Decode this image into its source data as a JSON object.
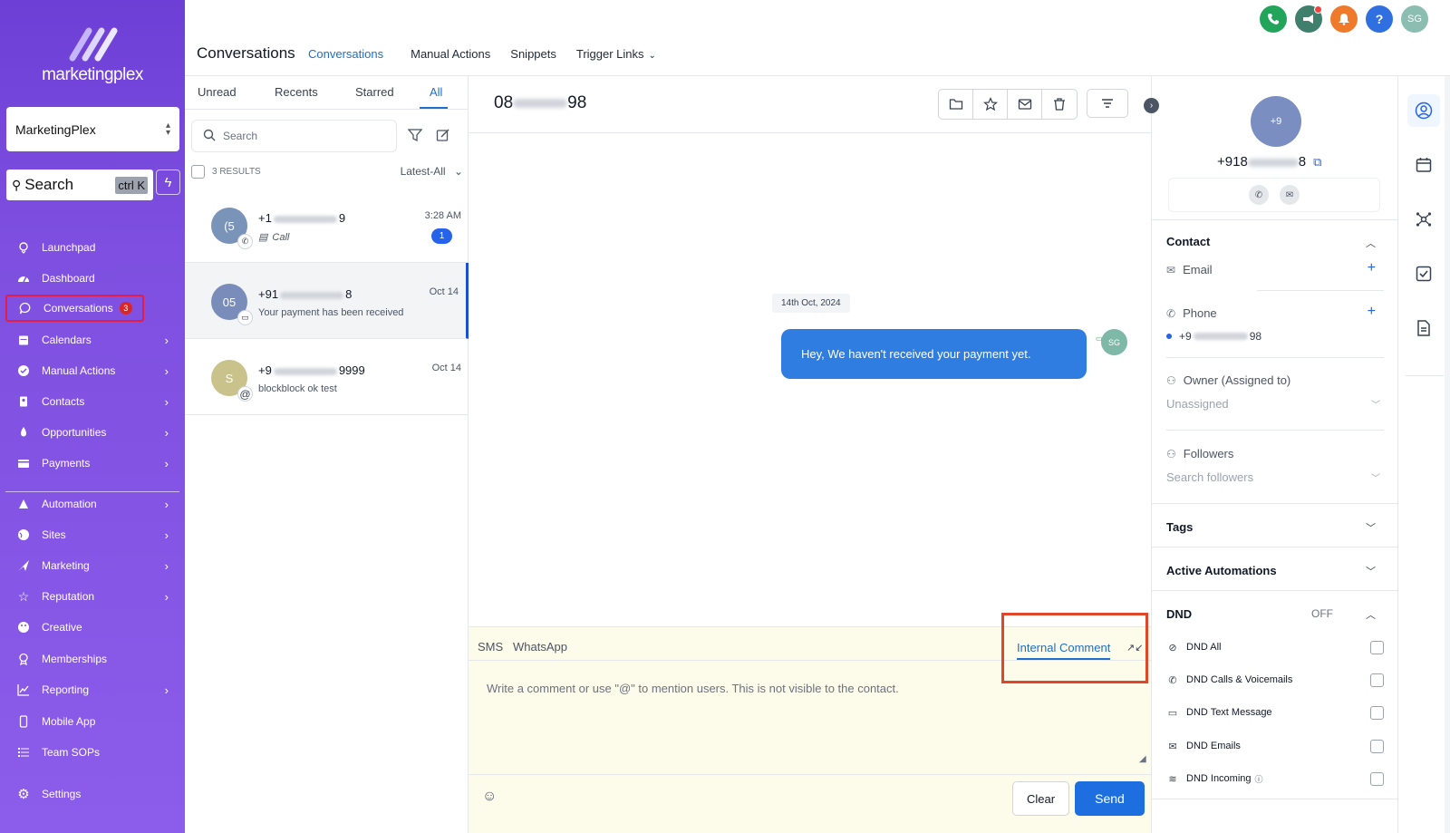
{
  "brand": {
    "name": "marketingplex"
  },
  "sidebar": {
    "account": "MarketingPlex",
    "search": {
      "placeholder": "Search",
      "shortcut": "ctrl K"
    },
    "items": [
      {
        "label": "Launchpad",
        "icon": "rocket-icon"
      },
      {
        "label": "Dashboard",
        "icon": "gauge-icon"
      },
      {
        "label": "Conversations",
        "icon": "chat-icon",
        "badge": "3",
        "active": true
      },
      {
        "label": "Calendars",
        "icon": "calendar-icon"
      },
      {
        "label": "Manual Actions",
        "icon": "check-circle-icon"
      },
      {
        "label": "Contacts",
        "icon": "contact-card-icon"
      },
      {
        "label": "Opportunities",
        "icon": "funnel-icon"
      },
      {
        "label": "Payments",
        "icon": "credit-card-icon"
      },
      {
        "label": "Automation",
        "icon": "robot-icon"
      },
      {
        "label": "Sites",
        "icon": "globe-icon"
      },
      {
        "label": "Marketing",
        "icon": "send-icon"
      },
      {
        "label": "Reputation",
        "icon": "star-icon"
      },
      {
        "label": "Creative",
        "icon": "palette-icon"
      },
      {
        "label": "Memberships",
        "icon": "award-icon"
      },
      {
        "label": "Reporting",
        "icon": "chart-icon"
      },
      {
        "label": "Mobile App",
        "icon": "phone-device-icon"
      },
      {
        "label": "Team SOPs",
        "icon": "list-icon"
      },
      {
        "label": "Settings",
        "icon": "gear-icon"
      }
    ]
  },
  "header": {
    "title": "Conversations",
    "tabs": [
      {
        "label": "Conversations",
        "active": true
      },
      {
        "label": "Manual Actions"
      },
      {
        "label": "Snippets"
      },
      {
        "label": "Trigger Links",
        "dropdown": true
      }
    ],
    "user_initials": "SG",
    "help": "?"
  },
  "conversation_list": {
    "tabs": [
      "Unread",
      "Recents",
      "Starred",
      "All"
    ],
    "active_tab": "All",
    "search_placeholder": "Search",
    "results": "3 RESULTS",
    "sort": "Latest-All",
    "items": [
      {
        "initials": "(5",
        "name_prefix": "+1",
        "name_suffix": "9",
        "subtitle": "Call",
        "time": "3:28 AM",
        "unread": "1",
        "avatar_color": "#7a93b8",
        "channel_icon": "phone-icon"
      },
      {
        "initials": "05",
        "name_prefix": "+91",
        "name_suffix": "8",
        "subtitle": "Your payment has been received",
        "time": "Oct 14",
        "avatar_color": "#7a8dba",
        "channel_icon": "message-icon",
        "selected": true
      },
      {
        "initials": "S",
        "name_prefix": "+9",
        "name_suffix": "9999",
        "subtitle": "blockblock ok test",
        "time": "Oct 14",
        "avatar_color": "#c9c28a",
        "channel_icon": "at-icon"
      }
    ]
  },
  "chat": {
    "phone_prefix": "08",
    "phone_suffix": "98",
    "date_label": "14th Oct, 2024",
    "messages": [
      {
        "text": "Hey, We haven't received your payment yet.",
        "author": "SG",
        "outgoing": true
      }
    ],
    "composer": {
      "channels": [
        "SMS",
        "WhatsApp"
      ],
      "active_channel": "Internal Comment",
      "placeholder": "Write a comment or use \"@\" to mention users. This is not visible to the contact.",
      "clear_label": "Clear",
      "send_label": "Send"
    }
  },
  "contact": {
    "avatar_text": "+9",
    "phone_prefix": "+918",
    "phone_suffix": "8",
    "sections": {
      "contact": "Contact",
      "email_label": "Email",
      "phone_label": "Phone",
      "phone_value_prefix": "+9",
      "phone_value_suffix": "98",
      "owner_label": "Owner (Assigned to)",
      "owner_value": "Unassigned",
      "followers_label": "Followers",
      "followers_placeholder": "Search followers",
      "tags": "Tags",
      "active_automations": "Active Automations",
      "dnd": "DND",
      "dnd_state": "OFF"
    },
    "dnd_options": [
      {
        "label": "DND All",
        "icon": "bell-off-icon"
      },
      {
        "label": "DND Calls & Voicemails",
        "icon": "phone-icon"
      },
      {
        "label": "DND Text Message",
        "icon": "message-icon"
      },
      {
        "label": "DND Emails",
        "icon": "mail-icon"
      },
      {
        "label": "DND Incoming",
        "icon": "wifi-off-icon",
        "info": true
      }
    ]
  },
  "colors": {
    "sidebar_top": "#6d3fd6",
    "accent": "#1d6fc9",
    "send": "#1d6fe0",
    "bubble": "#2f7de1",
    "highlight": "#e0472a"
  }
}
